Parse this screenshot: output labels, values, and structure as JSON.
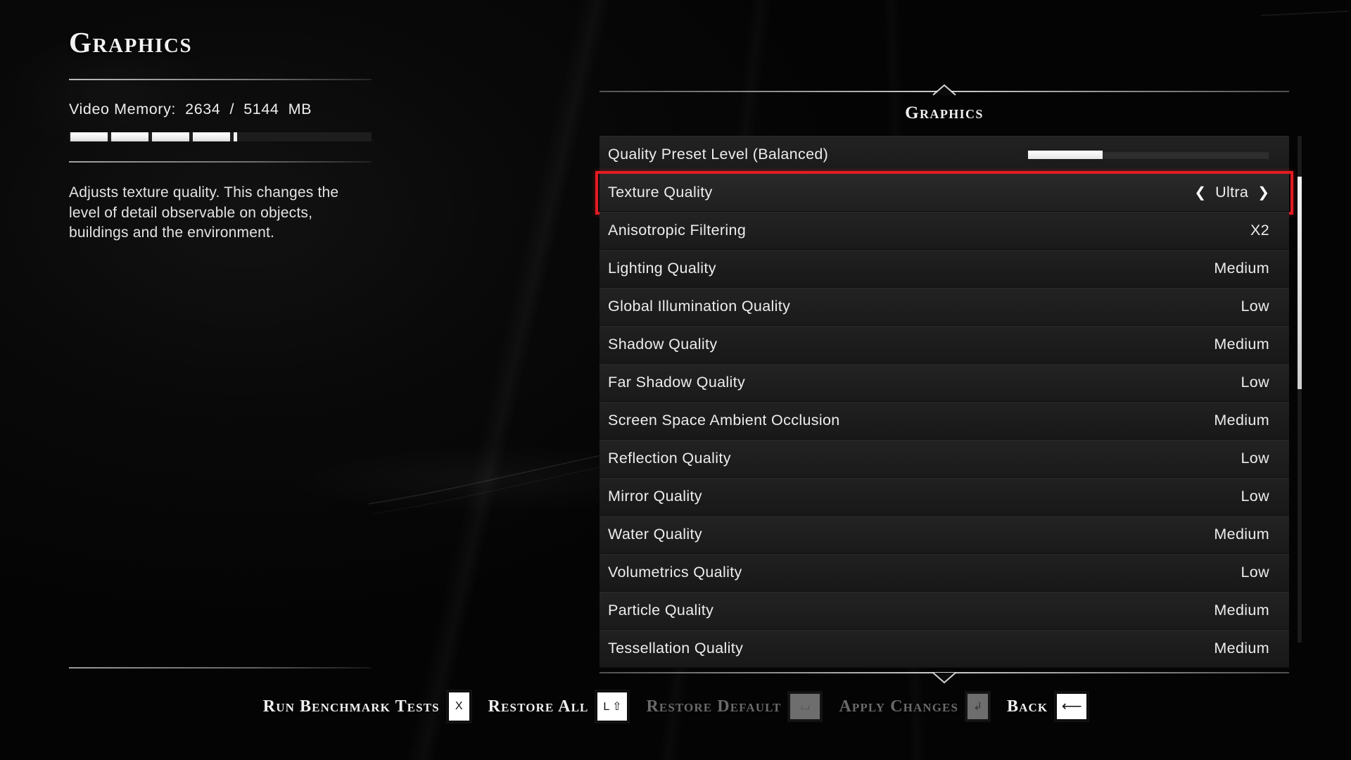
{
  "left": {
    "page_title": "Graphics",
    "vram_label": "Video Memory:  2634  /  5144  MB",
    "vram_used_mb": 2634,
    "vram_total_mb": 5144,
    "description": "Adjusts texture quality. This changes the level of detail observable on objects, buildings and the environment."
  },
  "panel": {
    "title": "Graphics",
    "rows": [
      {
        "label": "Quality Preset Level  (Balanced)",
        "value": "",
        "control": "slider",
        "slider_percent": 31
      },
      {
        "label": "Texture Quality",
        "value": "Ultra",
        "control": "stepper",
        "selected": true
      },
      {
        "label": "Anisotropic Filtering",
        "value": "X2",
        "control": "value"
      },
      {
        "label": "Lighting Quality",
        "value": "Medium",
        "control": "value"
      },
      {
        "label": "Global Illumination Quality",
        "value": "Low",
        "control": "value"
      },
      {
        "label": "Shadow Quality",
        "value": "Medium",
        "control": "value"
      },
      {
        "label": "Far Shadow Quality",
        "value": "Low",
        "control": "value"
      },
      {
        "label": "Screen Space Ambient Occlusion",
        "value": "Medium",
        "control": "value"
      },
      {
        "label": "Reflection Quality",
        "value": "Low",
        "control": "value"
      },
      {
        "label": "Mirror Quality",
        "value": "Low",
        "control": "value"
      },
      {
        "label": "Water Quality",
        "value": "Medium",
        "control": "value"
      },
      {
        "label": "Volumetrics Quality",
        "value": "Low",
        "control": "value"
      },
      {
        "label": "Particle Quality",
        "value": "Medium",
        "control": "value"
      },
      {
        "label": "Tessellation Quality",
        "value": "Medium",
        "control": "value"
      }
    ],
    "stepper": {
      "left_chevron": "❮",
      "right_chevron": "❯"
    },
    "scroll": {
      "thumb_top_percent": 8,
      "thumb_height_percent": 42
    },
    "highlight_color": "#e21b22"
  },
  "footer": {
    "buttons": [
      {
        "label": "Run Benchmark Tests",
        "key": "X",
        "disabled": false
      },
      {
        "label": "Restore All",
        "key": "L ⇧",
        "disabled": false
      },
      {
        "label": "Restore Default",
        "key": "⌴",
        "disabled": true
      },
      {
        "label": "Apply Changes",
        "key": "↲",
        "disabled": true
      },
      {
        "label": "Back",
        "key": "⟵",
        "disabled": false
      }
    ]
  }
}
